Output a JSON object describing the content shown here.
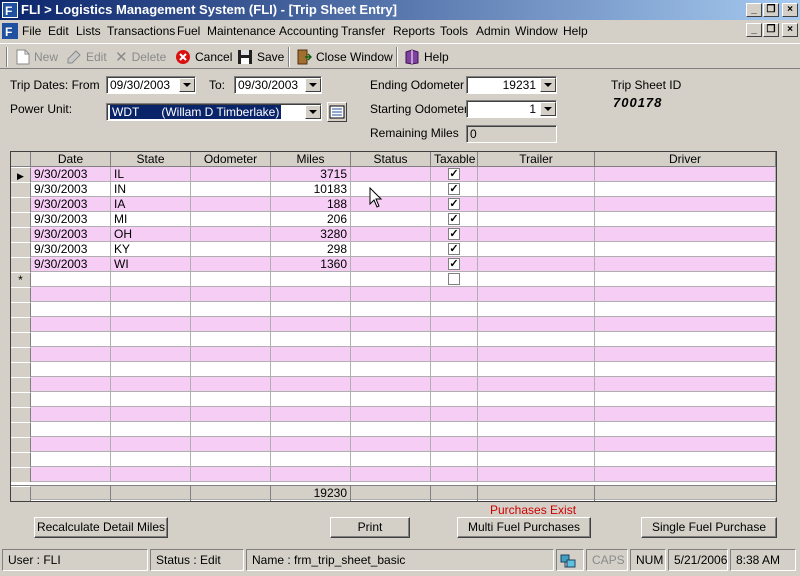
{
  "window": {
    "title": "FLI > Logistics Management System (FLI) - [Trip Sheet Entry]"
  },
  "menu": [
    "File",
    "Edit",
    "Lists",
    "Transactions",
    "Fuel",
    "Maintenance",
    "Accounting",
    "Transfer",
    "Reports",
    "Tools",
    "Admin",
    "Window",
    "Help"
  ],
  "toolbar": {
    "new": "New",
    "edit": "Edit",
    "delete": "Delete",
    "cancel": "Cancel",
    "save": "Save",
    "close_window": "Close Window",
    "help": "Help"
  },
  "form": {
    "trip_dates_label": "Trip Dates: From",
    "from_date": "09/30/2003",
    "to_label": "To:",
    "to_date": "09/30/2003",
    "power_unit_label": "Power Unit:",
    "power_unit_code": "WDT",
    "power_unit_name": "(Willam D Timberlake)",
    "ending_odometer_label": "Ending Odometer",
    "ending_odometer": "19231",
    "starting_odometer_label": "Starting Odometer",
    "starting_odometer": "1",
    "remaining_miles_label": "Remaining Miles",
    "remaining_miles": "0",
    "trip_sheet_id_label": "Trip Sheet ID",
    "trip_sheet_id": "700178"
  },
  "grid": {
    "columns": [
      "Date",
      "State",
      "Odometer",
      "Miles",
      "Status",
      "Taxable",
      "Trailer",
      "Driver"
    ],
    "rows": [
      {
        "date": "9/30/2003",
        "state": "IL",
        "odometer": "",
        "miles": "3715",
        "status": "",
        "taxable": true,
        "trailer": "",
        "driver": ""
      },
      {
        "date": "9/30/2003",
        "state": "IN",
        "odometer": "",
        "miles": "10183",
        "status": "",
        "taxable": true,
        "trailer": "",
        "driver": ""
      },
      {
        "date": "9/30/2003",
        "state": "IA",
        "odometer": "",
        "miles": "188",
        "status": "",
        "taxable": true,
        "trailer": "",
        "driver": ""
      },
      {
        "date": "9/30/2003",
        "state": "MI",
        "odometer": "",
        "miles": "206",
        "status": "",
        "taxable": true,
        "trailer": "",
        "driver": ""
      },
      {
        "date": "9/30/2003",
        "state": "OH",
        "odometer": "",
        "miles": "3280",
        "status": "",
        "taxable": true,
        "trailer": "",
        "driver": ""
      },
      {
        "date": "9/30/2003",
        "state": "KY",
        "odometer": "",
        "miles": "298",
        "status": "",
        "taxable": true,
        "trailer": "",
        "driver": ""
      },
      {
        "date": "9/30/2003",
        "state": "WI",
        "odometer": "",
        "miles": "1360",
        "status": "",
        "taxable": true,
        "trailer": "",
        "driver": ""
      }
    ],
    "new_row_marker": "*",
    "total_miles": "19230"
  },
  "notice": "Purchases Exist",
  "buttons": {
    "recalculate": "Recalculate Detail Miles",
    "print": "Print",
    "multi_fuel": "Multi Fuel Purchases",
    "single_fuel": "Single Fuel  Purchase"
  },
  "statusbar": {
    "user": "User : FLI",
    "status": "Status : Edit",
    "name": "Name : frm_trip_sheet_basic",
    "caps": "CAPS",
    "num": "NUM",
    "date": "5/21/2006",
    "time": "8:38 AM"
  },
  "colors": {
    "title_start": "#0a246a",
    "title_end": "#a6caf0",
    "row_pink": "#f5cdf5",
    "notice_red": "#cc0000",
    "cancel_red": "#d91010"
  }
}
